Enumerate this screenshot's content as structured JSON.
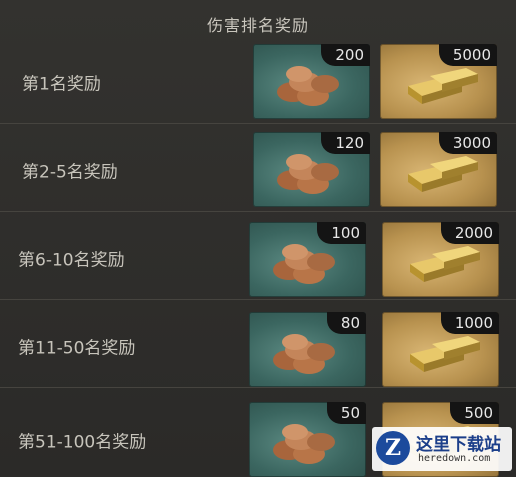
{
  "title": "伤害排名奖励",
  "rewards": [
    {
      "rank": "第1名奖励",
      "coin_qty": "200",
      "gold_qty": "5000"
    },
    {
      "rank": "第2-5名奖励",
      "coin_qty": "120",
      "gold_qty": "3000"
    },
    {
      "rank": "第6-10名奖励",
      "coin_qty": "100",
      "gold_qty": "2000"
    },
    {
      "rank": "第11-50名奖励",
      "coin_qty": "80",
      "gold_qty": "1000"
    },
    {
      "rank": "第51-100名奖励",
      "coin_qty": "50",
      "gold_qty": "500"
    }
  ],
  "icons": {
    "coin": "coin-pile-icon",
    "gold": "gold-bars-icon",
    "watermark_logo": "z-logo-icon"
  },
  "watermark": {
    "cn": "这里下载站",
    "url": "heredown.com"
  },
  "colors": {
    "background": "#2c2b29",
    "coin_tile": "#3b6660",
    "gold_tile": "#b8924f",
    "qty_badge": "#141414"
  }
}
